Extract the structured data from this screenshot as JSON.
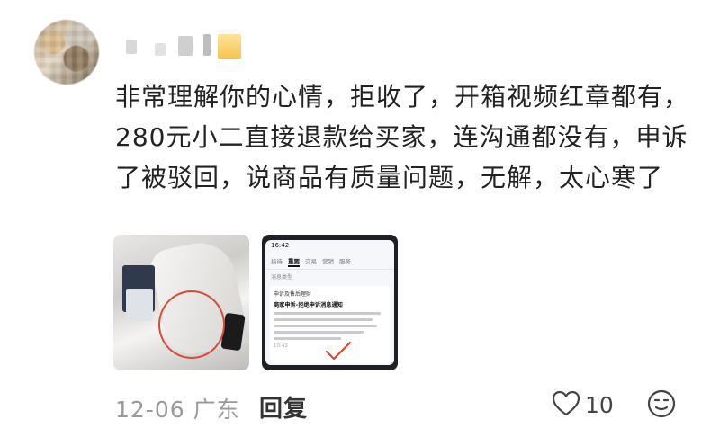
{
  "comment": {
    "text": "非常理解你的心情，拒收了，开箱视频红章都有， 280元小二直接退款给买家，连沟通都没有，申诉了被驳回，说商品有质量问题，无解，太心寒了"
  },
  "screenshot_preview": {
    "status_time": "16:42",
    "tabs": [
      "接待",
      "重要",
      "交易",
      "营销",
      "服务"
    ],
    "active_tab": "重要",
    "sub_header": "消息类型",
    "card_title": "申诉及售后理财",
    "card_heading": "商家申诉-拒绝申诉消息通知",
    "card_time": "10:43"
  },
  "footer": {
    "date": "12-06",
    "location": "广东",
    "reply_label": "回复",
    "like_count": "10"
  },
  "icons": {
    "like": "heart-outline-icon",
    "emoji": "emoji-face-icon"
  },
  "colors": {
    "text_primary": "#222222",
    "meta_gray": "#9a9a9a",
    "annotation_red": "#d94a3a"
  }
}
